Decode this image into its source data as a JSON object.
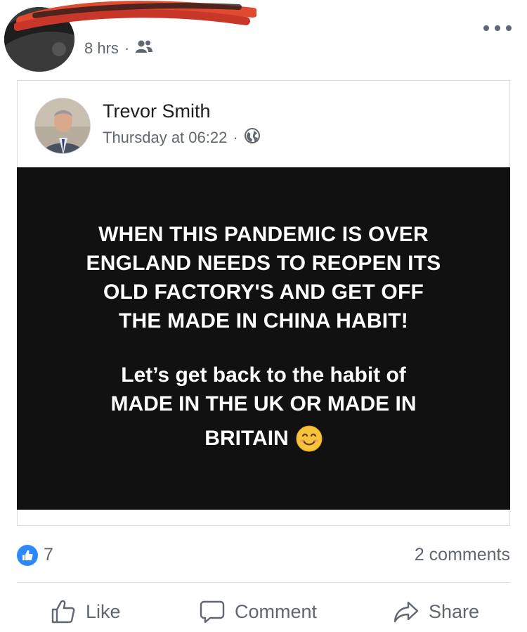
{
  "sharer": {
    "time": "8 hrs",
    "separator": "·",
    "audience_icon": "friends-icon",
    "more_icon": "more-options-icon"
  },
  "post": {
    "author": "Trevor Smith",
    "time": "Thursday at 06:22",
    "separator": "·",
    "privacy_icon": "globe-icon",
    "text_lines_1": [
      "WHEN THIS PANDEMIC IS OVER",
      "ENGLAND NEEDS TO REOPEN ITS",
      "OLD FACTORY'S AND GET OFF",
      "THE MADE IN CHINA HABIT!"
    ],
    "text_lines_2": [
      "Let’s get back to the habit of",
      "MADE IN THE UK OR MADE IN"
    ],
    "text_last_line": "BRITAIN",
    "emoji": "smiling-face-emoji"
  },
  "reactions": {
    "like_count": "7",
    "comments": "2 comments"
  },
  "actions": {
    "like": "Like",
    "comment": "Comment",
    "share": "Share"
  },
  "colors": {
    "accent": "#2d88ff",
    "post_background": "#111111",
    "meta_text": "#606770"
  }
}
